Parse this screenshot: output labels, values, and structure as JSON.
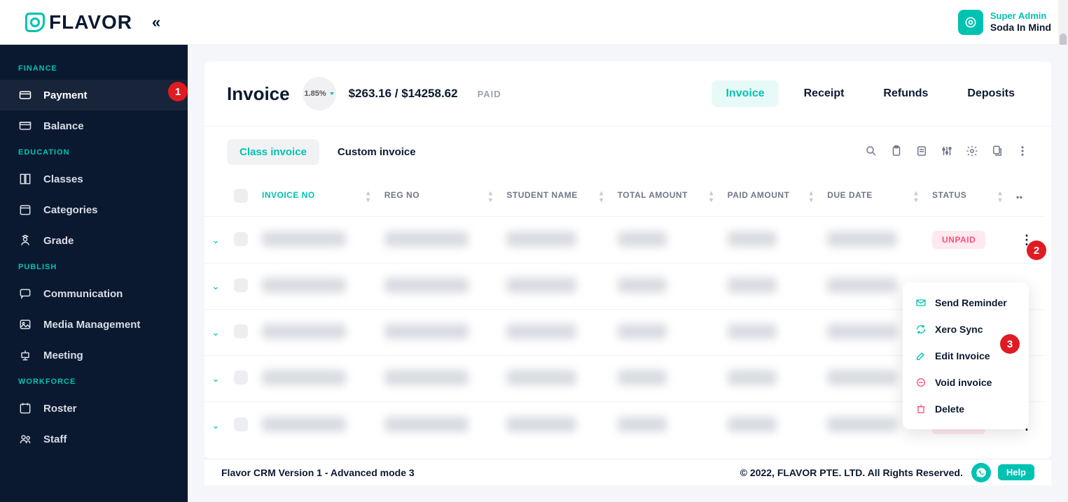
{
  "app": {
    "brand": "FLAVOR"
  },
  "user": {
    "role": "Super Admin",
    "name": "Soda In Mind"
  },
  "sidebar": {
    "sections": [
      {
        "label": "FINANCE",
        "items": [
          {
            "label": "Payment",
            "icon": "card",
            "active": true
          },
          {
            "label": "Balance",
            "icon": "wallet",
            "active": false
          }
        ]
      },
      {
        "label": "EDUCATION",
        "items": [
          {
            "label": "Classes",
            "icon": "book",
            "active": false
          },
          {
            "label": "Categories",
            "icon": "calendar",
            "active": false
          },
          {
            "label": "Grade",
            "icon": "person-hat",
            "active": false
          }
        ]
      },
      {
        "label": "PUBLISH",
        "items": [
          {
            "label": "Communication",
            "icon": "chat",
            "active": false
          },
          {
            "label": "Media Management",
            "icon": "image",
            "active": false
          },
          {
            "label": "Meeting",
            "icon": "podium",
            "active": false
          }
        ]
      },
      {
        "label": "WORKFORCE",
        "items": [
          {
            "label": "Roster",
            "icon": "calendar2",
            "active": false
          },
          {
            "label": "Staff",
            "icon": "people",
            "active": false
          }
        ]
      }
    ]
  },
  "page": {
    "title": "Invoice",
    "percent": "1.85%",
    "summary_amount": "$263.16 / $14258.62",
    "summary_label": "PAID",
    "topTabs": [
      {
        "label": "Invoice",
        "active": true
      },
      {
        "label": "Receipt",
        "active": false
      },
      {
        "label": "Refunds",
        "active": false
      },
      {
        "label": "Deposits",
        "active": false
      }
    ],
    "subTabs": [
      {
        "label": "Class invoice",
        "active": true
      },
      {
        "label": "Custom invoice",
        "active": false
      }
    ],
    "columns": [
      {
        "label": "INVOICE NO",
        "sorted": true
      },
      {
        "label": "REG NO",
        "sorted": false
      },
      {
        "label": "STUDENT NAME",
        "sorted": false
      },
      {
        "label": "TOTAL AMOUNT",
        "sorted": false
      },
      {
        "label": "PAID AMOUNT",
        "sorted": false
      },
      {
        "label": "DUE DATE",
        "sorted": false
      },
      {
        "label": "STATUS",
        "sorted": false
      }
    ],
    "rows": [
      {
        "status": "UNPAID",
        "showStatus": true,
        "showMenu": true
      },
      {
        "status": "",
        "showStatus": false,
        "showMenu": false
      },
      {
        "status": "",
        "showStatus": false,
        "showMenu": false
      },
      {
        "status": "",
        "showStatus": false,
        "showMenu": false
      },
      {
        "status": "UNPAID",
        "showStatus": true,
        "showMenu": true
      }
    ],
    "rowActions": [
      {
        "label": "Send Reminder",
        "icon": "mail"
      },
      {
        "label": "Xero Sync",
        "icon": "sync"
      },
      {
        "label": "Edit Invoice",
        "icon": "edit"
      },
      {
        "label": "Void invoice",
        "icon": "void"
      },
      {
        "label": "Delete",
        "icon": "trash"
      }
    ]
  },
  "footer": {
    "left": "Flavor CRM Version 1 - Advanced mode 3",
    "right": "© 2022, FLAVOR PTE. LTD. All Rights Reserved.",
    "help": "Help"
  },
  "callouts": [
    "1",
    "2",
    "3"
  ]
}
